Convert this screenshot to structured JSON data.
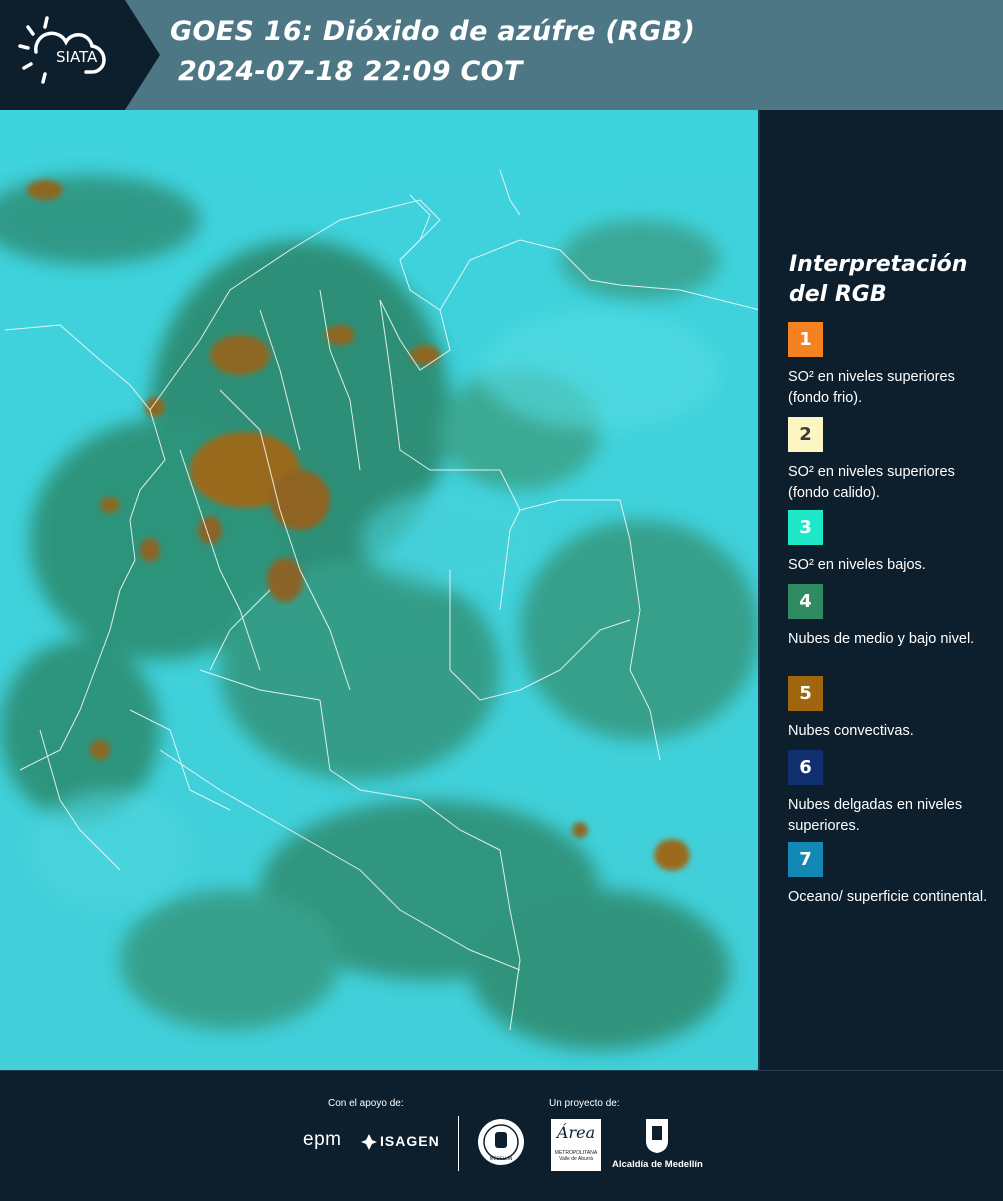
{
  "header": {
    "logo_text": "SIATA",
    "title": "GOES 16: Dióxido de azúfre (RGB)",
    "datetime": "2024-07-18 22:09 COT"
  },
  "legend": {
    "title_line1": "Interpretación",
    "title_line2": "del RGB",
    "items": [
      {
        "number": "1",
        "color": "#f58220",
        "text": "SO² en niveles superiores (fondo frio)."
      },
      {
        "number": "2",
        "color": "#fdf6c3",
        "text": "SO² en niveles superiores (fondo calido)."
      },
      {
        "number": "3",
        "color": "#1de9c8",
        "text": "SO² en niveles bajos."
      },
      {
        "number": "4",
        "color": "#2e8b62",
        "text": "Nubes de medio y bajo nivel."
      },
      {
        "number": "5",
        "color": "#a0650f",
        "text": "Nubes convectivas."
      },
      {
        "number": "6",
        "color": "#0f2f6e",
        "text": "Nubes delgadas en niveles superiores."
      },
      {
        "number": "7",
        "color": "#1488b5",
        "text": "Oceano/ superficie continental."
      }
    ]
  },
  "footer": {
    "support_label": "Con el apoyo de:",
    "project_label": "Un proyecto de:",
    "epm": "epm",
    "isagen": "ISAGEN",
    "area_name": "Área",
    "area_sub": "METROPOLITANA",
    "area_sub2": "Valle de Aburrá",
    "alcaldia": "Alcaldía de Medellín",
    "seal_text": "MEDELLÍN"
  },
  "colors": {
    "header_bg": "#4e7786",
    "logo_bg": "#0d1f2d",
    "panel_bg": "#0d1f2d",
    "ocean": "#3fd0dc",
    "cloud_green": "#2f8a6a",
    "convective": "#9a6a1e"
  }
}
